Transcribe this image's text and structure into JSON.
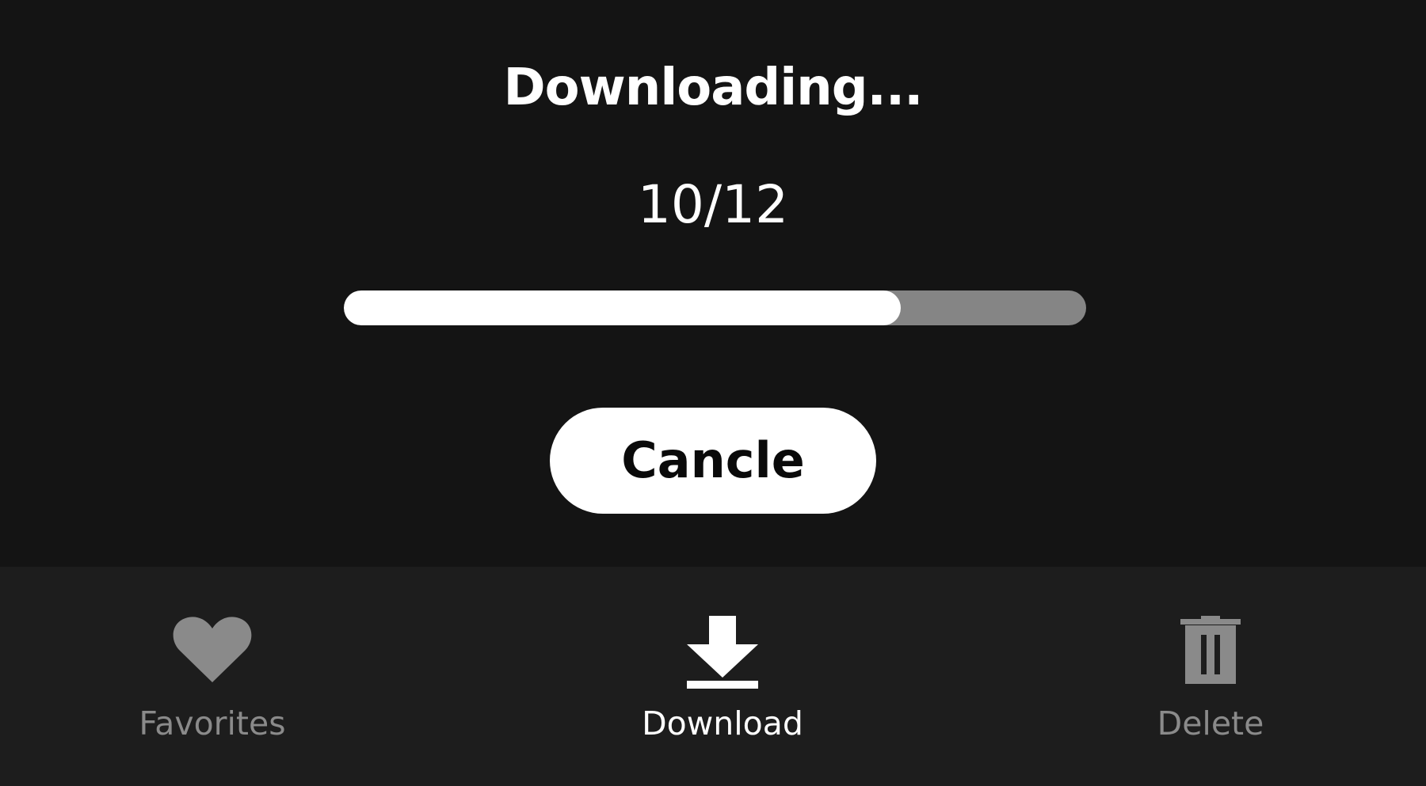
{
  "dialog": {
    "title": "Downloading...",
    "counter_text": "10/12",
    "progress": {
      "current": 10,
      "total": 12
    },
    "cancel_label": "Cancle"
  },
  "bottom_nav": {
    "items": [
      {
        "label": "Favorites",
        "icon": "heart-icon",
        "active": false
      },
      {
        "label": "Download",
        "icon": "download-icon",
        "active": true
      },
      {
        "label": "Delete",
        "icon": "trash-icon",
        "active": false
      }
    ]
  },
  "colors": {
    "background": "#131313",
    "bottom_bar": "#1d1d1d",
    "progress_fill": "#ffffff",
    "progress_track": "#858585",
    "active_text": "#ffffff",
    "inactive_text": "#8a8a8a"
  }
}
